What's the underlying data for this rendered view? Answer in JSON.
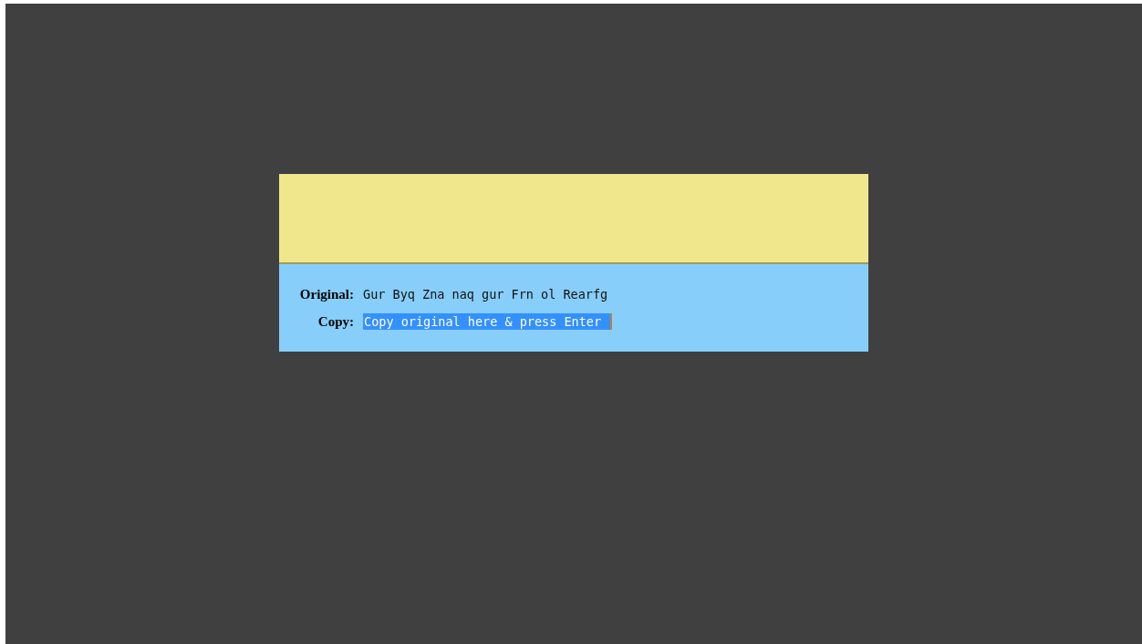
{
  "prompt": {
    "original_label": "Original:",
    "original_text": "Gur Byq Zna naq gur Frn ol Rearfg",
    "copy_label": "Copy:",
    "copy_value": "Copy original here & press Enter",
    "copy_selected": true
  }
}
